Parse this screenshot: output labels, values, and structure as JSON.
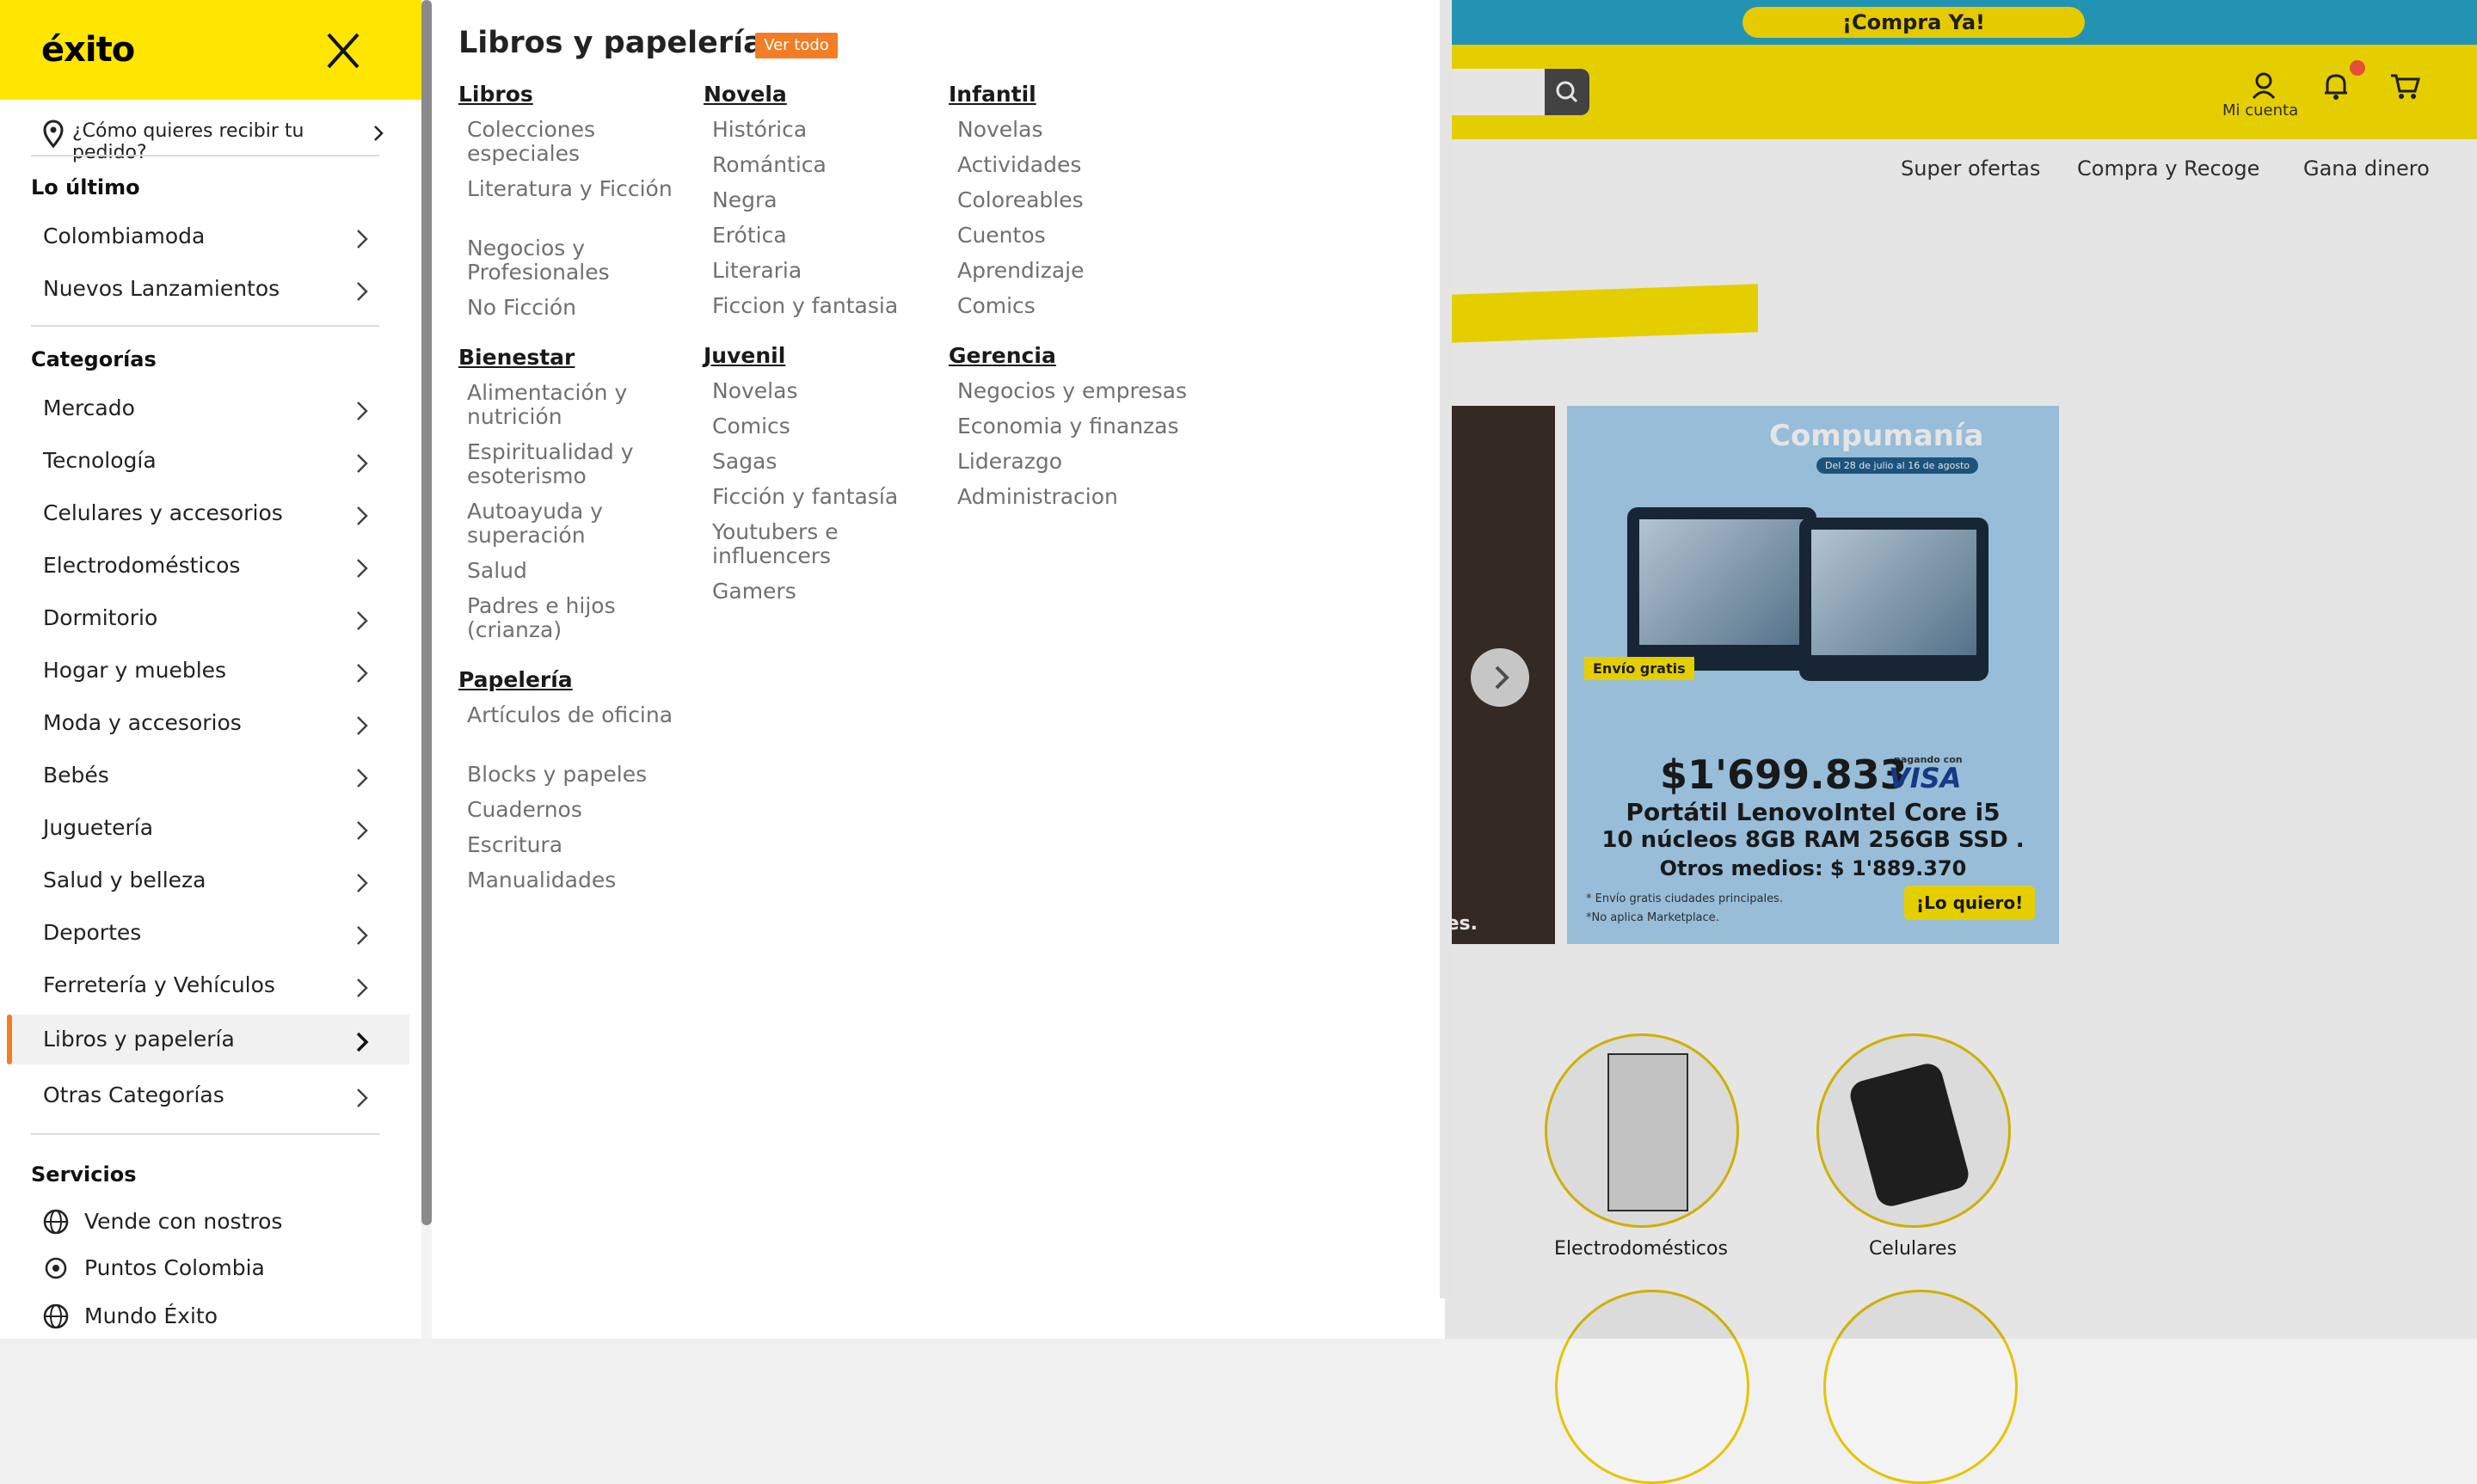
{
  "background": {
    "compra_ya": "¡Compra Ya!",
    "account_label": "Mi cuenta",
    "subnav": [
      "Super ofertas",
      "Compra y Recoge",
      "Gana dinero"
    ],
    "banner": {
      "title": "Compumanía",
      "dates": "Del 28 de julio al 16 de agosto",
      "envio": "Envío gratis",
      "price": "$1'699.833",
      "pagando": "pagando con",
      "visa": "VISA",
      "product": "Portátil LenovoIntel Core i5",
      "specs": "10 núcleos 8GB RAM 256GB SSD .",
      "otros": "Otros medios: $ 1'889.370",
      "note1": "* Envío gratis ciudades principales.",
      "note2": "*No aplica Marketplace.",
      "cta": "¡Lo quiero!"
    },
    "left_banner_text": "onibles.",
    "circles": [
      "Electrodomésticos",
      "Celulares"
    ]
  },
  "sidebar": {
    "logo": "éxito",
    "delivery_prompt": "¿Cómo quieres recibir tu pedido?",
    "sections": {
      "latest_title": "Lo último",
      "latest": [
        "Colombiamoda",
        "Nuevos Lanzamientos"
      ],
      "categories_title": "Categorías",
      "categories": [
        "Mercado",
        "Tecnología",
        "Celulares y accesorios",
        "Electrodomésticos",
        "Dormitorio",
        "Hogar y muebles",
        "Moda y accesorios",
        "Bebés",
        "Juguetería",
        "Salud y belleza",
        "Deportes",
        "Ferretería y Vehículos",
        "Libros y papelería",
        "Otras Categorías"
      ],
      "active_category": "Libros y papelería",
      "services_title": "Servicios",
      "services": [
        "Vende con nostros",
        "Puntos Colombia",
        "Mundo Éxito"
      ]
    }
  },
  "panel": {
    "title": "Libros y papelería",
    "ver_todo": "Ver todo",
    "columns": [
      [
        {
          "title": "Libros",
          "items": [
            "Colecciones especiales",
            "Literatura y Ficción",
            "Negocios y Profesionales",
            "No Ficción"
          ]
        },
        {
          "title": "Bienestar",
          "items": [
            "Alimentación y nutrición",
            "Espiritualidad y esoterismo",
            "Autoayuda y superación",
            "Salud",
            "Padres e hijos (crianza)"
          ]
        },
        {
          "title": "Papelería",
          "items": [
            "Artículos de oficina",
            "Blocks y papeles",
            "Cuadernos",
            "Escritura",
            "Manualidades"
          ]
        }
      ],
      [
        {
          "title": "Novela",
          "items": [
            "Histórica",
            "Romántica",
            "Negra",
            "Erótica",
            "Literaria",
            "Ficcion y fantasia"
          ]
        },
        {
          "title": "Juvenil",
          "items": [
            "Novelas",
            "Comics",
            "Sagas",
            "Ficción y fantasía",
            "Youtubers e influencers",
            "Gamers"
          ]
        }
      ],
      [
        {
          "title": "Infantil",
          "items": [
            "Novelas",
            "Actividades",
            "Coloreables",
            "Cuentos",
            "Aprendizaje",
            "Comics"
          ]
        },
        {
          "title": "Gerencia",
          "items": [
            "Negocios y empresas",
            "Economia y finanzas",
            "Liderazgo",
            "Administracion"
          ]
        }
      ]
    ]
  },
  "colors": {
    "brand_yellow": "#ffe600",
    "accent_orange": "#f27d26",
    "topbar_blue": "#27a4c9"
  }
}
